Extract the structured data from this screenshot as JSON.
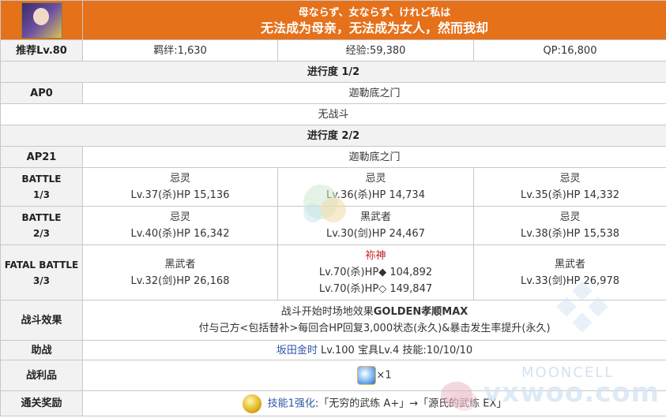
{
  "header": {
    "subtitle_jp": "母ならず、女ならず、けれど私は",
    "title_cn": "无法成为母亲，无法成为女人，然而我却"
  },
  "info": {
    "rec_level": "推荐Lv.80",
    "bond": "羁绊:1,630",
    "exp": "经验:59,380",
    "qp": "QP:16,800"
  },
  "progress1": {
    "label": "进行度 1/2",
    "ap": "AP0",
    "location": "迦勒底之门",
    "note": "无战斗"
  },
  "progress2": {
    "label": "进行度 2/2",
    "ap": "AP21",
    "location": "迦勒底之门"
  },
  "battles": [
    {
      "label_top": "BATTLE",
      "label_bottom": "1/3",
      "enemies": [
        {
          "name": "忌灵",
          "stats": "Lv.37(杀)HP 15,136"
        },
        {
          "name": "忌灵",
          "stats": "Lv.36(杀)HP 14,734"
        },
        {
          "name": "忌灵",
          "stats": "Lv.35(杀)HP 14,332"
        }
      ]
    },
    {
      "label_top": "BATTLE",
      "label_bottom": "2/3",
      "enemies": [
        {
          "name": "忌灵",
          "stats": "Lv.40(杀)HP 16,342"
        },
        {
          "name": "黑武者",
          "stats": "Lv.30(剑)HP 24,467"
        },
        {
          "name": "忌灵",
          "stats": "Lv.38(杀)HP 15,538"
        }
      ]
    },
    {
      "label_top": "FATAL BATTLE",
      "label_bottom": "3/3",
      "enemies": [
        {
          "name": "黑武者",
          "stats": "Lv.32(剑)HP 26,168"
        },
        {
          "name": "袮神",
          "stats": "Lv.70(杀)HP◆ 104,892",
          "stats2": "Lv.70(杀)HP◇ 149,847"
        },
        {
          "name": "黑武者",
          "stats": "Lv.33(剑)HP 26,978"
        }
      ]
    }
  ],
  "effect": {
    "label": "战斗效果",
    "line1_prefix": "战斗开始时场地效果",
    "line1_bold": "GOLDEN孝顺MAX",
    "line2": "付与己方<包括替补>每回合HP回复3,000状态(永久)&暴击发生率提升(永久)"
  },
  "support": {
    "label": "助战",
    "servant": "坂田金时",
    "detail": " Lv.100 宝具Lv.4 技能:10/10/10"
  },
  "drops": {
    "label": "战利品",
    "count": "×1"
  },
  "reward": {
    "label": "通关奖励",
    "link": "技能1强化",
    "text": ":「无穷的武练 A+」→「源氏的武练 EX」"
  },
  "watermark": {
    "brand": "MOONCELL",
    "site": "vxwoo.com"
  },
  "colors": {
    "header_bg": "#e5711b",
    "label_bg": "#f2f2f2",
    "boss_name": "#c51e1e",
    "link": "#2e55a6"
  }
}
